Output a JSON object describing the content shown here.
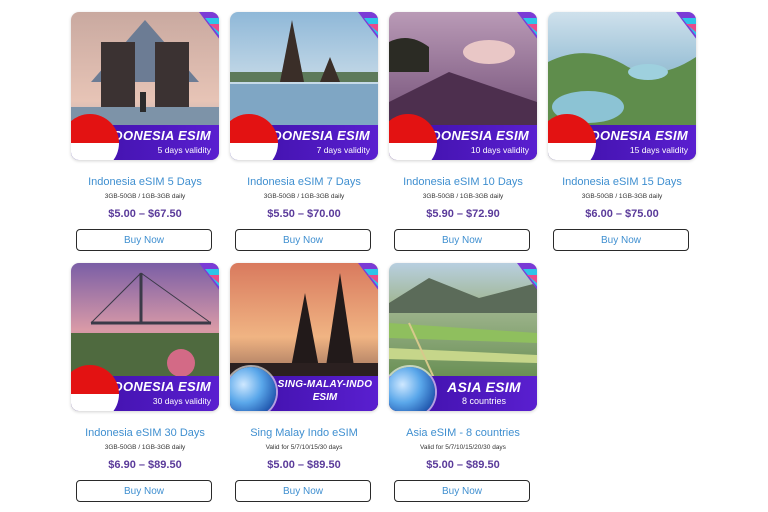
{
  "products": [
    {
      "name": "Indonesia eSIM 5 Days",
      "detail": "3GB-50GB / 1GB-3GB daily",
      "price": "$5.00 – $67.50",
      "banner_title": "INDONESIA ESIM",
      "banner_sub": "5 days validity",
      "button": "Buy Now"
    },
    {
      "name": "Indonesia eSIM 7 Days",
      "detail": "3GB-50GB / 1GB-3GB daily",
      "price": "$5.50 – $70.00",
      "banner_title": "INDONESIA ESIM",
      "banner_sub": "7 days validity",
      "button": "Buy Now"
    },
    {
      "name": "Indonesia eSIM 10 Days",
      "detail": "3GB-50GB / 1GB-3GB daily",
      "price": "$5.90 – $72.90",
      "banner_title": "INDONESIA ESIM",
      "banner_sub": "10 days validity",
      "button": "Buy Now"
    },
    {
      "name": "Indonesia eSIM 15 Days",
      "detail": "3GB-50GB / 1GB-3GB daily",
      "price": "$6.00 – $75.00",
      "banner_title": "INDONESIA ESIM",
      "banner_sub": "15 days validity",
      "button": "Buy Now"
    },
    {
      "name": "Indonesia eSIM 30 Days",
      "detail": "3GB-50GB / 1GB-3GB daily",
      "price": "$6.90 – $89.50",
      "banner_title": "INDONESIA ESIM",
      "banner_sub": "30 days validity",
      "button": "Buy Now"
    },
    {
      "name": "Sing Malay Indo eSIM",
      "detail": "Valid for 5/7/10/15/30 days",
      "price": "$5.00 – $89.50",
      "banner_title": "SING-MALAY-INDO",
      "banner_sub": "ESIM",
      "button": "Buy Now"
    },
    {
      "name": "Asia eSIM - 8 countries",
      "detail": "Valid for 5/7/10/15/20/30 days",
      "price": "$5.00 – $89.50",
      "banner_title": "ASIA ESIM",
      "banner_sub": "8 countries",
      "button": "Buy Now"
    }
  ],
  "colors": {
    "banner": "#4a17bd",
    "link": "#3f8fd0",
    "price": "#5a3a9a",
    "flag_red": "#e31212"
  }
}
